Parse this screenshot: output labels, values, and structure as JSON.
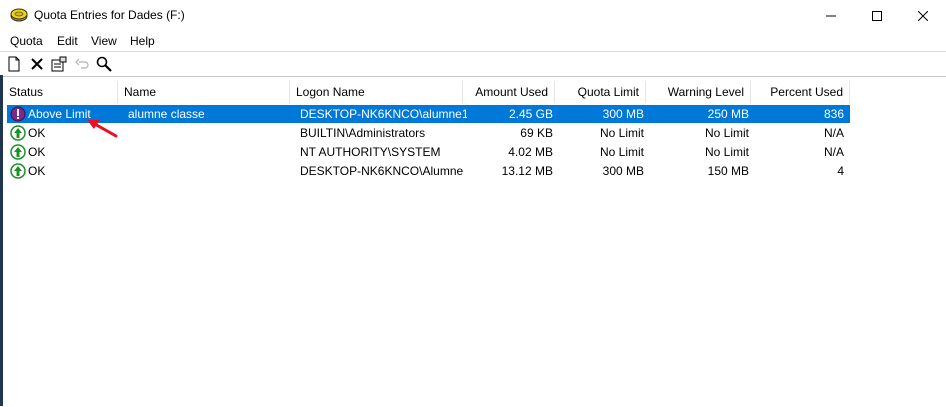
{
  "window": {
    "title": "Quota Entries for Dades (F:)",
    "minimize_glyph": "—",
    "maximize_glyph": "☐",
    "close_glyph": "✕"
  },
  "menu": [
    "Quota",
    "Edit",
    "View",
    "Help"
  ],
  "toolbar": {
    "buttons": [
      "new-quota-entry-icon",
      "delete-icon",
      "properties-icon",
      "undo-icon",
      "find-icon"
    ]
  },
  "columns": [
    "Status",
    "Name",
    "Logon Name",
    "Amount Used",
    "Quota Limit",
    "Warning Level",
    "Percent Used"
  ],
  "rows": [
    {
      "status": "Above Limit",
      "status_icon": "warning-icon",
      "name": "alumne classe",
      "logon": "DESKTOP-NK6KNCO\\alumne1",
      "amount": "2.45 GB",
      "limit": "300 MB",
      "warning": "250 MB",
      "percent": "836",
      "selected": true
    },
    {
      "status": "OK",
      "status_icon": "ok-icon",
      "name": "",
      "logon": "BUILTIN\\Administrators",
      "amount": "69 KB",
      "limit": "No Limit",
      "warning": "No Limit",
      "percent": "N/A",
      "selected": false
    },
    {
      "status": "OK",
      "status_icon": "ok-icon",
      "name": "",
      "logon": "NT AUTHORITY\\SYSTEM",
      "amount": "4.02 MB",
      "limit": "No Limit",
      "warning": "No Limit",
      "percent": "N/A",
      "selected": false
    },
    {
      "status": "OK",
      "status_icon": "ok-icon",
      "name": "",
      "logon": "DESKTOP-NK6KNCO\\Alumne",
      "amount": "13.12 MB",
      "limit": "300 MB",
      "warning": "150 MB",
      "percent": "4",
      "selected": false
    }
  ],
  "colors": {
    "selection": "#0078d7",
    "annotation_arrow": "#e81123",
    "warning_icon": "#7a2a8c",
    "ok_icon": "#1f8f2a"
  }
}
